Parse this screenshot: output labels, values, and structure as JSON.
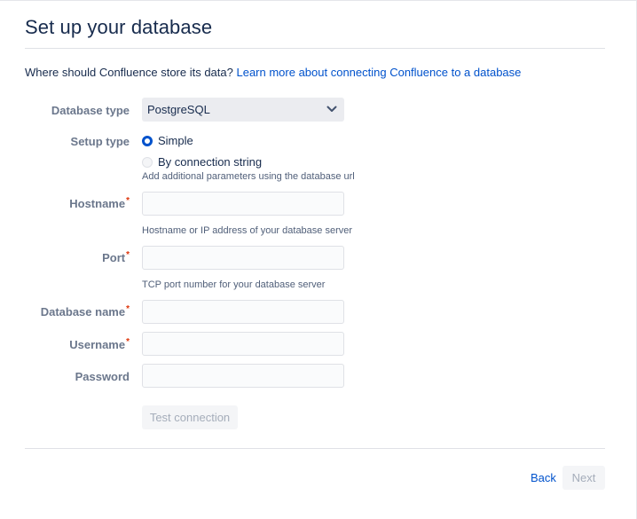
{
  "page": {
    "title": "Set up your database",
    "intro_text": "Where should Confluence store its data?",
    "intro_link": "Learn more about connecting Confluence to a database"
  },
  "form": {
    "database_type": {
      "label": "Database type",
      "selected": "PostgreSQL"
    },
    "setup_type": {
      "label": "Setup type",
      "options": [
        {
          "label": "Simple",
          "selected": true
        },
        {
          "label": "By connection string",
          "selected": false
        }
      ],
      "help": "Add additional parameters using the database url"
    },
    "hostname": {
      "label": "Hostname",
      "required_mark": "*",
      "value": "",
      "help": "Hostname or IP address of your database server"
    },
    "port": {
      "label": "Port",
      "required_mark": "*",
      "value": "",
      "help": "TCP port number for your database server"
    },
    "database_name": {
      "label": "Database name",
      "required_mark": "*",
      "value": ""
    },
    "username": {
      "label": "Username",
      "required_mark": "*",
      "value": ""
    },
    "password": {
      "label": "Password",
      "value": ""
    },
    "test_connection_label": "Test connection"
  },
  "footer": {
    "back_label": "Back",
    "next_label": "Next"
  },
  "colors": {
    "link": "#0052cc",
    "required": "#de350b",
    "label": "#6b778c",
    "disabled_text": "#a5adba"
  }
}
